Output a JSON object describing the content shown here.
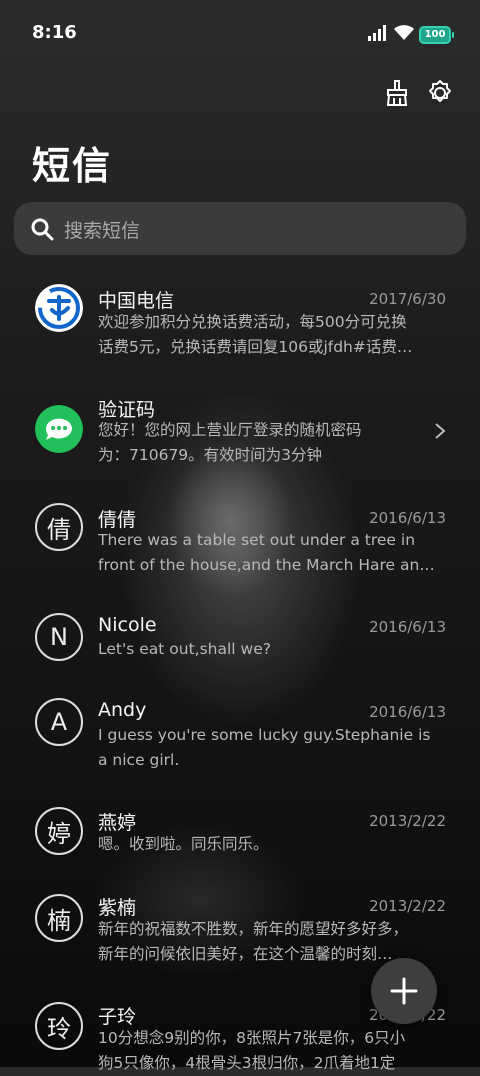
{
  "status_bar": {
    "time": "8:16",
    "battery": "100",
    "icons": [
      "signal-icon",
      "wifi-icon",
      "battery-icon"
    ]
  },
  "toolbar": {
    "icons": [
      "broom-icon",
      "gear-icon"
    ]
  },
  "page": {
    "title": "短信"
  },
  "search": {
    "placeholder": "搜索短信"
  },
  "colors": {
    "accent_battery": "#36d0b4",
    "wechat_green": "#21c05a",
    "telecom_blue": "#1366c9"
  },
  "messages": [
    {
      "avatar": "",
      "avatar_type": "china-telecom-logo",
      "name": "中国电信",
      "date": "2017/6/30",
      "line1": "欢迎参加积分兑换话费活动，每500分可兑换",
      "line2": "话费5元，兑换话费请回复106或jfdh#话费…"
    },
    {
      "avatar": "",
      "avatar_type": "chat-bubble-icon",
      "name": "验证码",
      "date": "",
      "line1": "您好！您的网上营业厅登录的随机密码",
      "line2": "为：710679。有效时间为3分钟"
    },
    {
      "avatar": "倩",
      "name": "倩倩",
      "date": "2016/6/13",
      "line1": "There was a table set out under a tree in",
      "line2": "front of the house,and the March Hare an…"
    },
    {
      "avatar": "N",
      "name": "Nicole",
      "date": "2016/6/13",
      "line1": "Let's eat out,shall we?",
      "line2": ""
    },
    {
      "avatar": "A",
      "name": "Andy",
      "date": "2016/6/13",
      "line1": "I guess you're some lucky guy.Stephanie is",
      "line2": "a nice girl."
    },
    {
      "avatar": "婷",
      "name": "燕婷",
      "date": "2013/2/22",
      "line1": "嗯。收到啦。同乐同乐。",
      "line2": ""
    },
    {
      "avatar": "楠",
      "name": "紫楠",
      "date": "2013/2/22",
      "line1": "新年的祝福数不胜数，新年的愿望好多好多，",
      "line2": "新年的问候依旧美好，在这个温馨的时刻…"
    },
    {
      "avatar": "玲",
      "name": "子玲",
      "date": "2013/2/22",
      "line1": "10分想念9别的你，8张照片7张是你，6只小",
      "line2": "狗5只像你，4根骨头3根归你，2爪着地1定"
    }
  ],
  "fab": {
    "icon": "plus-icon"
  }
}
